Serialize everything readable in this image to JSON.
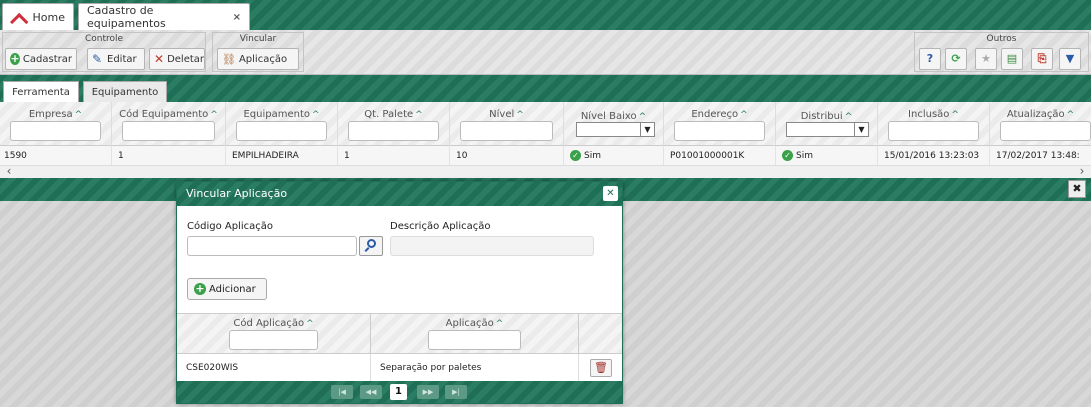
{
  "tabs": {
    "home": "Home",
    "cadastro": "Cadastro de equipamentos",
    "close": "×"
  },
  "toolbar": {
    "controle_title": "Controle",
    "vincular_title": "Vincular",
    "outros_title": "Outros",
    "cadastrar": "Cadastrar",
    "editar": "Editar",
    "deletar": "Deletar",
    "aplicacao": "Aplicação",
    "icons": [
      "help-icon",
      "refresh-icon",
      "star-icon",
      "excel-icon",
      "pdf-icon",
      "filter-icon"
    ]
  },
  "section_tabs": {
    "ferramenta": "Ferramenta",
    "equipamento": "Equipamento"
  },
  "grid": {
    "columns": [
      "Empresa",
      "Cód Equipamento",
      "Equipamento",
      "Qt. Palete",
      "Nível",
      "Nível Baixo",
      "Endereço",
      "Distribui",
      "Inclusão",
      "Atualização"
    ],
    "row": {
      "empresa": "1590",
      "cod_equipamento": "1",
      "equipamento": "EMPILHADEIRA",
      "qt_palete": "1",
      "nivel": "10",
      "nivel_baixo": "Sim",
      "endereco": "P01001000001K",
      "distribui": "Sim",
      "inclusao": "15/01/2016 13:23:03",
      "atualizacao": "17/02/2017 13:48:"
    }
  },
  "modal": {
    "title": "Vincular Aplicação",
    "codigo_label": "Código Aplicação",
    "descricao_label": "Descrição Aplicação",
    "codigo_value": "",
    "descricao_value": "",
    "adicionar": "Adicionar",
    "table": {
      "col_cod": "Cód Aplicação",
      "col_app": "Aplicação",
      "rows": [
        {
          "cod": "CSE020WIS",
          "app": "Separação por paletes"
        }
      ]
    },
    "pager": {
      "first": "|◀",
      "prev": "◀◀",
      "current": "1",
      "next": "▶▶",
      "last": "▶|"
    }
  },
  "colors": {
    "primary": "#1f6f57",
    "success": "#3aa04a",
    "danger": "#c0392b"
  }
}
